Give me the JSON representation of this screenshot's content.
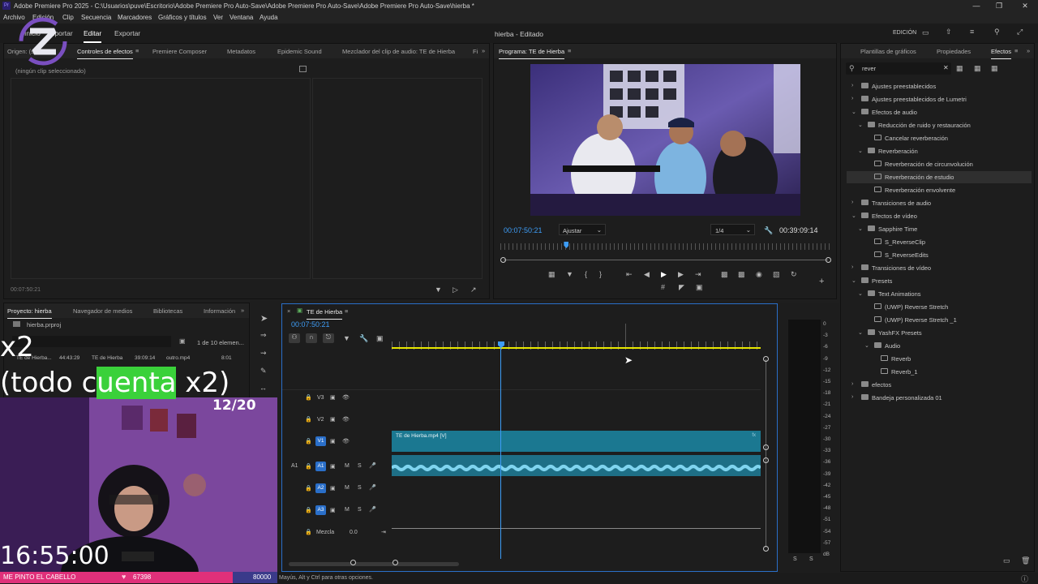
{
  "window": {
    "logo": "Pr",
    "title": "Adobe Premiere Pro 2025 - C:\\Usuarios\\puve\\Escritorio\\Adobe Premiere Pro Auto-Save\\Adobe Premiere Pro Auto-Save\\Adobe Premiere Pro Auto-Save\\hierba *"
  },
  "menu": [
    "Archivo",
    "Edición",
    "Clip",
    "Secuencia",
    "Marcadores",
    "Gráficos y títulos",
    "Ver",
    "Ventana",
    "Ayuda"
  ],
  "workspace": {
    "tabs": [
      "Inicio",
      "Importar",
      "Editar",
      "Exportar"
    ],
    "active": "Editar",
    "project_title": "hierba - Editado",
    "mode_label": "EDICIÓN"
  },
  "source_panel": {
    "tabs": [
      "Origen: (sin clips)",
      "Controles de efectos",
      "Premiere Composer",
      "Metadatos",
      "Epidemic Sound",
      "Mezclador del clip de audio: TE de Hierba",
      "Fi"
    ],
    "no_clip": "(ningún clip seleccionado)",
    "timecode": "00:07:50:21"
  },
  "program_panel": {
    "title": "Programa: TE de Hierba",
    "timecode": "00:07:50:21",
    "fit": "Ajustar",
    "resolution": "1/4",
    "duration": "00:39:09:14",
    "playhead_fraction": 0.2
  },
  "right_panel": {
    "tabs": [
      "Plantillas de gráficos",
      "Propiedades",
      "Efectos"
    ],
    "search_value": "rever",
    "tree": [
      {
        "label": "Ajustes preestablecidos",
        "level": 0,
        "type": "folder",
        "open": false
      },
      {
        "label": "Ajustes preestablecidos de Lumetri",
        "level": 0,
        "type": "folder",
        "open": false
      },
      {
        "label": "Efectos de audio",
        "level": 0,
        "type": "folder",
        "open": true
      },
      {
        "label": "Reducción de ruido y restauración",
        "level": 1,
        "type": "folder",
        "open": true
      },
      {
        "label": "Cancelar reverberación",
        "level": 2,
        "type": "fx"
      },
      {
        "label": "Reverberación",
        "level": 1,
        "type": "folder",
        "open": true
      },
      {
        "label": "Reverberación de circunvolución",
        "level": 2,
        "type": "fx"
      },
      {
        "label": "Reverberación de estudio",
        "level": 2,
        "type": "fx",
        "selected": true
      },
      {
        "label": "Reverberación envolvente",
        "level": 2,
        "type": "fx"
      },
      {
        "label": "Transiciones de audio",
        "level": 0,
        "type": "folder",
        "open": false
      },
      {
        "label": "Efectos de vídeo",
        "level": 0,
        "type": "folder",
        "open": true
      },
      {
        "label": "Sapphire Time",
        "level": 1,
        "type": "folder",
        "open": true
      },
      {
        "label": "S_ReverseClip",
        "level": 2,
        "type": "fx"
      },
      {
        "label": "S_ReverseEdits",
        "level": 2,
        "type": "fx"
      },
      {
        "label": "Transiciones de vídeo",
        "level": 0,
        "type": "folder",
        "open": false
      },
      {
        "label": "Presets",
        "level": 0,
        "type": "folder",
        "open": true
      },
      {
        "label": "Text Animations",
        "level": 1,
        "type": "folder",
        "open": true
      },
      {
        "label": "(UWP) Reverse Stretch",
        "level": 2,
        "type": "fx"
      },
      {
        "label": "(UWP) Reverse Stretch _1",
        "level": 2,
        "type": "fx"
      },
      {
        "label": "YashFX Presets",
        "level": 1,
        "type": "folder",
        "open": true
      },
      {
        "label": "Audio",
        "level": 2,
        "type": "folder",
        "open": true
      },
      {
        "label": "Reverb",
        "level": 3,
        "type": "fx"
      },
      {
        "label": "Reverb_1",
        "level": 3,
        "type": "fx"
      },
      {
        "label": "efectos",
        "level": 0,
        "type": "folder",
        "open": false
      },
      {
        "label": "Bandeja personalizada 01",
        "level": 0,
        "type": "folder",
        "open": false
      }
    ]
  },
  "project_panel": {
    "tabs": [
      "Proyecto: hierba",
      "Navegador de medios",
      "Bibliotecas",
      "Información"
    ],
    "file": "hierba.prproj",
    "count": "1 de 10 elemen...",
    "items": [
      {
        "name": "TE de Hierba...",
        "dur": "44:43:29"
      },
      {
        "name": "TE de Hierba",
        "dur": "39:09:14"
      },
      {
        "name": "outro.mp4",
        "dur": "8:01"
      }
    ]
  },
  "timeline": {
    "title": "TE de Hierba",
    "timecode": "00:07:50:21",
    "video_tracks": [
      "V3",
      "V2",
      "V1"
    ],
    "audio_tracks": [
      "A1",
      "A2",
      "A3"
    ],
    "source_audio": "A1",
    "clip_name": "TE de Hierba.mp4 [V]",
    "mix_label": "Mezcla",
    "mix_value": "0.0"
  },
  "meter": {
    "scale": [
      "0",
      "-3",
      "-6",
      "-9",
      "-12",
      "-15",
      "-18",
      "-21",
      "-24",
      "-27",
      "-30",
      "-33",
      "-36",
      "-39",
      "-42",
      "-45",
      "-48",
      "-51",
      "-54",
      "-57",
      "dB"
    ],
    "solo_labels": [
      "S",
      "S"
    ]
  },
  "status_bar": "Mayús, Alt y Ctrl para otras opciones.",
  "overlay": {
    "line1": "x2",
    "line2a": "(todo c",
    "line2b": "uenta",
    "line2c": " x2)",
    "counter": "12/20",
    "clock": "16:55:00",
    "goal_text": "ME PINTO EL CABELLO",
    "goal_current": "67398",
    "goal_target": "80000",
    "goal_fraction": 0.84,
    "goal_color": "#e0307a",
    "highlight_color": "#3ad13a"
  },
  "colors": {
    "accent": "#3d9cf5",
    "clip_video": "#1b7891",
    "clip_audio": "#1e6f86",
    "track_badge": "#2a6fc9",
    "workarea": "#e6e600"
  }
}
